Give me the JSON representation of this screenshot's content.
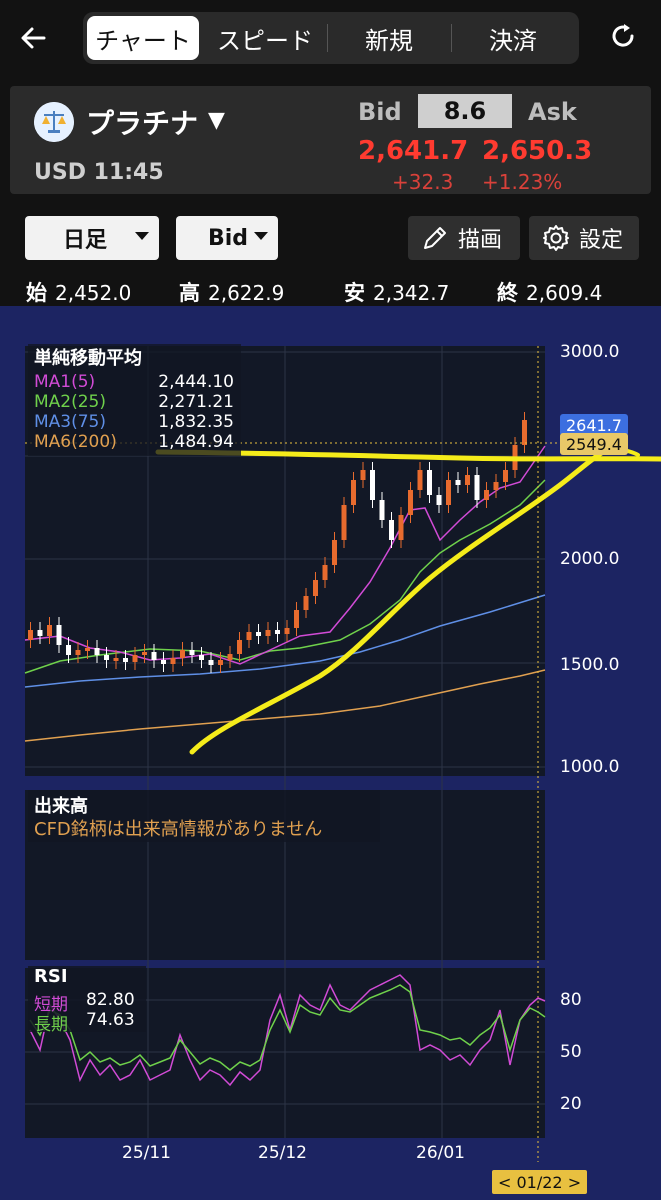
{
  "nav": {
    "tabs": [
      "チャート",
      "スピード",
      "新規",
      "決済"
    ]
  },
  "instrument": {
    "name": "プラチナ",
    "dropdown_arrow": "▼",
    "sub": "USD 11:45",
    "bid_label": "Bid",
    "ask_label": "Ask",
    "spread": "8.6",
    "bid": "2,641.7",
    "ask": "2,650.3",
    "bid_change": "+32.3",
    "ask_change": "+1.23%"
  },
  "controls": {
    "period": "日足",
    "price_type": "Bid",
    "draw_label": "描画",
    "settings_label": "設定"
  },
  "ohlc": {
    "open_label": "始",
    "open": "2,452.0",
    "high_label": "高",
    "high": "2,622.9",
    "low_label": "安",
    "low": "2,342.7",
    "close_label": "終",
    "close": "2,609.4"
  },
  "legend": {
    "title": "単純移動平均",
    "items": [
      {
        "name": "MA1(5)",
        "value": "2,444.10",
        "color": "#d14bd6"
      },
      {
        "name": "MA2(25)",
        "value": "2,271.21",
        "color": "#6fd14b"
      },
      {
        "name": "MA3(75)",
        "value": "1,832.35",
        "color": "#5f8fe6"
      },
      {
        "name": "MA6(200)",
        "value": "1,484.94",
        "color": "#e0a050"
      }
    ]
  },
  "price_axis": [
    "3000.0",
    "2000.0",
    "1500.0",
    "1000.0"
  ],
  "price_tags": {
    "current": "2641.7",
    "level": "2549.4"
  },
  "volume": {
    "title": "出来高",
    "message": "CFD銘柄は出来高情報がありません"
  },
  "rsi": {
    "title": "RSI",
    "short_label": "短期",
    "short_value": "82.80",
    "long_label": "長期",
    "long_value": "74.63",
    "axis": [
      "80",
      "50",
      "20"
    ]
  },
  "x_axis": [
    "25/11",
    "25/12",
    "26/01"
  ],
  "cursor_date": "< 01/22 >",
  "colors": {
    "up": "#e86b2e",
    "down": "#ffffff",
    "bid_red": "#ff3b30",
    "chart_bg": "#1c2462",
    "annotation": "#f5ec1a"
  }
}
